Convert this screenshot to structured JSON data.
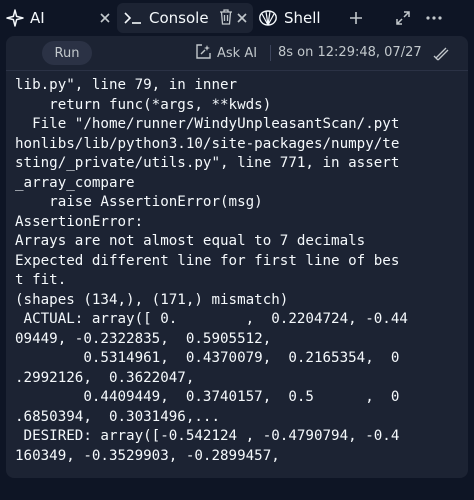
{
  "tabs": [
    {
      "label": "AI",
      "icon": "sparkle-icon"
    },
    {
      "label": "Console",
      "icon": "terminal-prompt-icon"
    },
    {
      "label": "Shell",
      "icon": "shell-icon"
    }
  ],
  "tab_actions": [
    "plus-icon",
    "expand-icon",
    "more-icon"
  ],
  "toolbar": {
    "run_label": "Run",
    "ask_ai_label": "Ask AI",
    "timestamp": "8s on 12:29:48, 07/27"
  },
  "console_lines": [
    "lib.py\", line 79, in inner",
    "    return func(*args, **kwds)",
    "  File \"/home/runner/WindyUnpleasantScan/.pyt",
    "honlibs/lib/python3.10/site-packages/numpy/te",
    "sting/_private/utils.py\", line 771, in assert",
    "_array_compare",
    "    raise AssertionError(msg)",
    "AssertionError:",
    "Arrays are not almost equal to 7 decimals",
    "Expected different line for first line of bes",
    "t fit.",
    "(shapes (134,), (171,) mismatch)",
    " ACTUAL: array([ 0.        ,  0.2204724, -0.44",
    "09449, -0.2322835,  0.5905512,",
    "        0.5314961,  0.4370079,  0.2165354,  0",
    ".2992126,  0.3622047,",
    "        0.4409449,  0.3740157,  0.5      ,  0",
    ".6850394,  0.3031496,...",
    " DESIRED: array([-0.542124 , -0.4790794, -0.4",
    "160349, -0.3529903, -0.2899457,"
  ],
  "colors": {
    "background": "#0e1525",
    "panel": "#1c2333",
    "text": "#f5f9fc",
    "muted": "#c2c8cc"
  }
}
